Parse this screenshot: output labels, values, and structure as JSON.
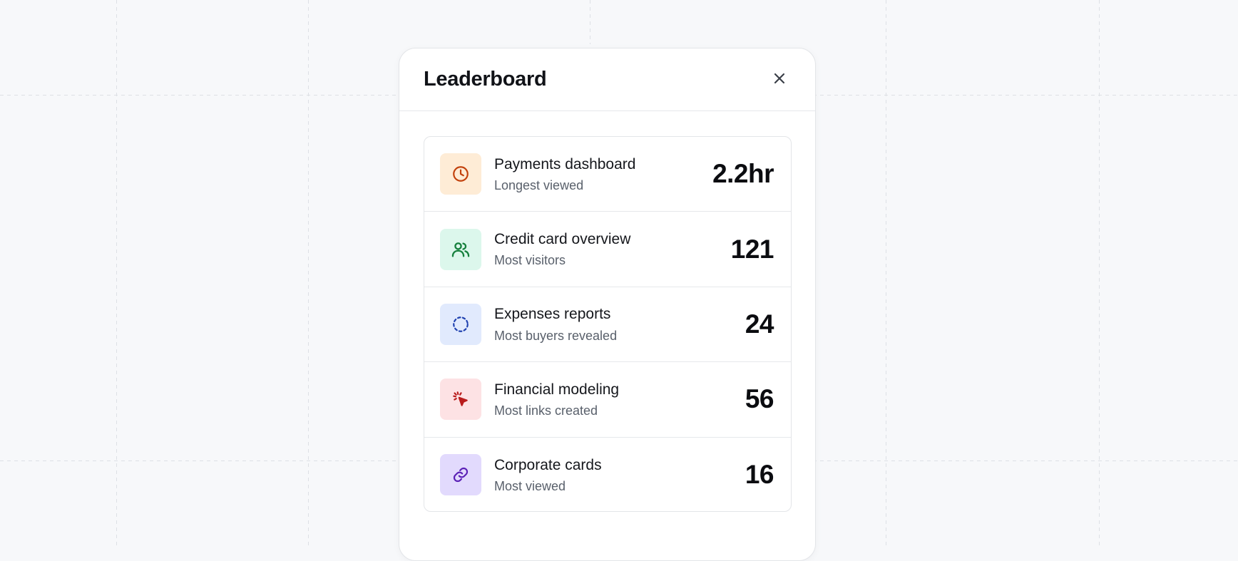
{
  "modal": {
    "title": "Leaderboard"
  },
  "icons": {
    "close": "close-icon"
  },
  "items": [
    {
      "title": "Payments dashboard",
      "subtitle": "Longest viewed",
      "value": "2.2hr",
      "icon": "clock-icon",
      "bg": "#feecd6",
      "color": "#c2410c"
    },
    {
      "title": "Credit card overview",
      "subtitle": "Most visitors",
      "value": "121",
      "icon": "users-icon",
      "bg": "#dcf7ec",
      "color": "#15803d"
    },
    {
      "title": "Expenses reports",
      "subtitle": "Most buyers revealed",
      "value": "24",
      "icon": "dashed-circle-icon",
      "bg": "#e1eafd",
      "color": "#1e40af"
    },
    {
      "title": "Financial modeling",
      "subtitle": "Most links created",
      "value": "56",
      "icon": "cursor-click-icon",
      "bg": "#fde2e4",
      "color": "#b91c1c"
    },
    {
      "title": "Corporate cards",
      "subtitle": "Most viewed",
      "value": "16",
      "icon": "link-icon",
      "bg": "#e2dafd",
      "color": "#5b21b6"
    }
  ]
}
